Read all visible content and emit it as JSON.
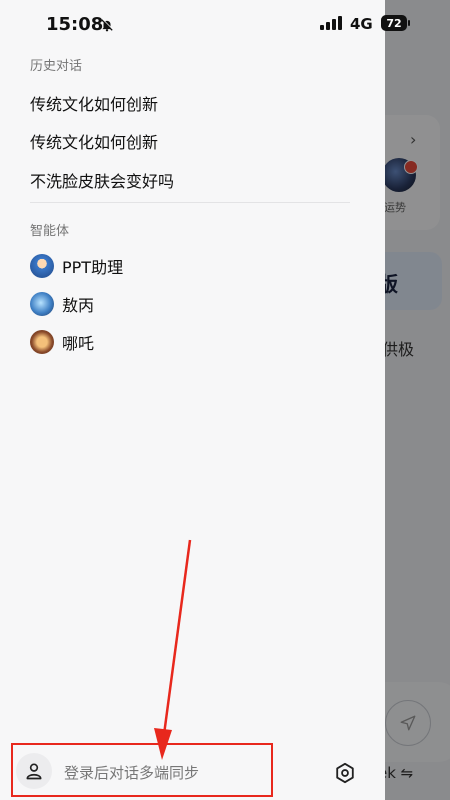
{
  "status_bar": {
    "time": "15:08",
    "network": "4G",
    "battery": "72"
  },
  "drawer": {
    "history_title": "历史对话",
    "history": [
      {
        "label": "传统文化如何创新"
      },
      {
        "label": "传统文化如何创新"
      },
      {
        "label": "不洗脸皮肤会变好吗"
      }
    ],
    "agents_title": "智能体",
    "agents": [
      {
        "label": "PPT助理",
        "icon": "ppt-assistant-avatar"
      },
      {
        "label": "敖丙",
        "icon": "aobing-avatar"
      },
      {
        "label": "哪吒",
        "icon": "nezha-avatar"
      }
    ],
    "login_text": "登录后对话多端同步"
  },
  "background_app": {
    "chevron": "›",
    "avatar_label": "运势",
    "blue_card_text": "版",
    "side_text": "供极",
    "bottom_text": "ek ⇋"
  },
  "annotation": {
    "color": "#e8281d"
  }
}
